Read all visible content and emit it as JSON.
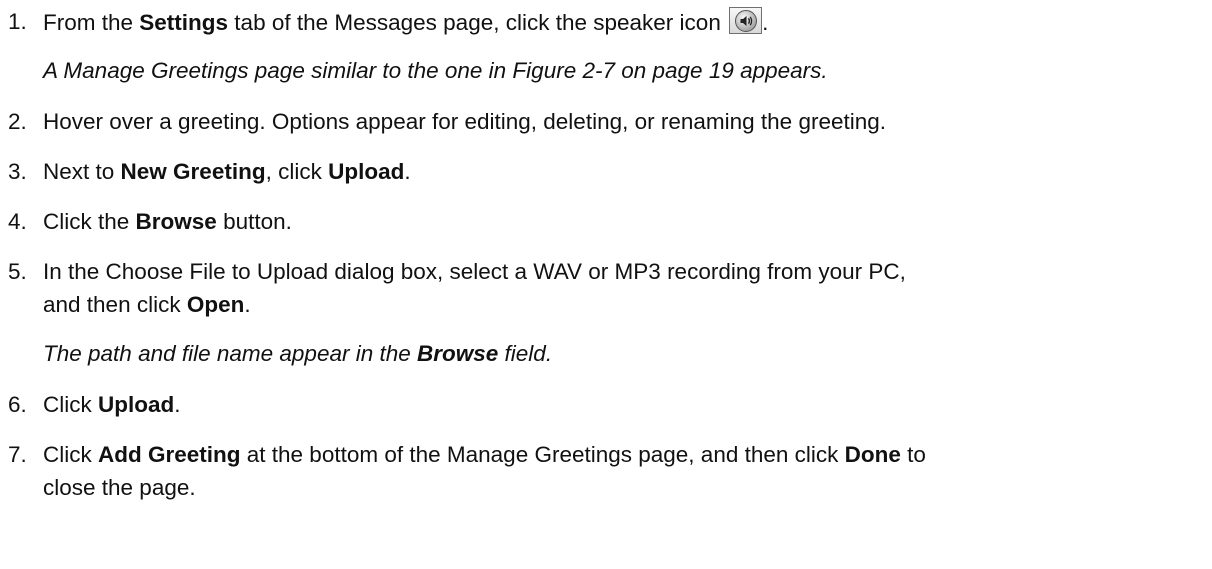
{
  "steps": [
    {
      "num": "1.",
      "p1": "From the ",
      "b1": "Settings",
      "p2": " tab of the Messages page, click the speaker icon ",
      "end": ".",
      "note": "A Manage Greetings page similar to the one in Figure 2-7 on page 19 appears."
    },
    {
      "num": "2.",
      "text": "Hover over a greeting. Options appear for editing, deleting, or renaming the greeting."
    },
    {
      "num": "3.",
      "p1": "Next to ",
      "b1": "New Greeting",
      "p2": ", click ",
      "b2": "Upload",
      "end": "."
    },
    {
      "num": "4.",
      "p1": "Click the ",
      "b1": "Browse",
      "p2": " button."
    },
    {
      "num": "5.",
      "line1": "In the Choose File to Upload dialog box, select a WAV or MP3 recording from your PC,",
      "p1": "and then click ",
      "b1": "Open",
      "end": ".",
      "note_p1": "The path and file name appear in the ",
      "note_b1": "Browse",
      "note_p2": " field."
    },
    {
      "num": "6.",
      "p1": "Click ",
      "b1": "Upload",
      "end": "."
    },
    {
      "num": "7.",
      "p1": "Click ",
      "b1": "Add Greeting",
      "p2": " at the bottom of the Manage Greetings page, and then click ",
      "b2": "Done",
      "p3": " to",
      "line2": "close the page."
    }
  ],
  "icons": {
    "speaker": "speaker-icon"
  }
}
